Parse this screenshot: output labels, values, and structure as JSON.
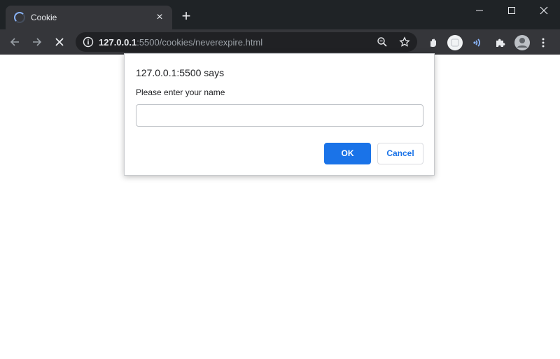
{
  "tab": {
    "title": "Cookie"
  },
  "address_bar": {
    "host": "127.0.0.1",
    "path": ":5500/cookies/neverexpire.html"
  },
  "dialog": {
    "title": "127.0.0.1:5500 says",
    "message": "Please enter your name",
    "input_value": "",
    "ok_label": "OK",
    "cancel_label": "Cancel"
  },
  "colors": {
    "accent": "#1a73e8",
    "tab_strip": "#1f2326",
    "toolbar": "#35363a",
    "omnibox": "#202124"
  },
  "icons": [
    "loading-spinner-icon",
    "close-icon",
    "plus-icon",
    "minimize-icon",
    "maximize-icon",
    "close-window-icon",
    "back-icon",
    "forward-icon",
    "stop-icon",
    "info-icon",
    "zoom-icon",
    "star-icon",
    "hand-extension-icon",
    "avatar-extension-icon",
    "sound-extension-icon",
    "puzzle-icon",
    "profile-icon",
    "menu-icon"
  ]
}
